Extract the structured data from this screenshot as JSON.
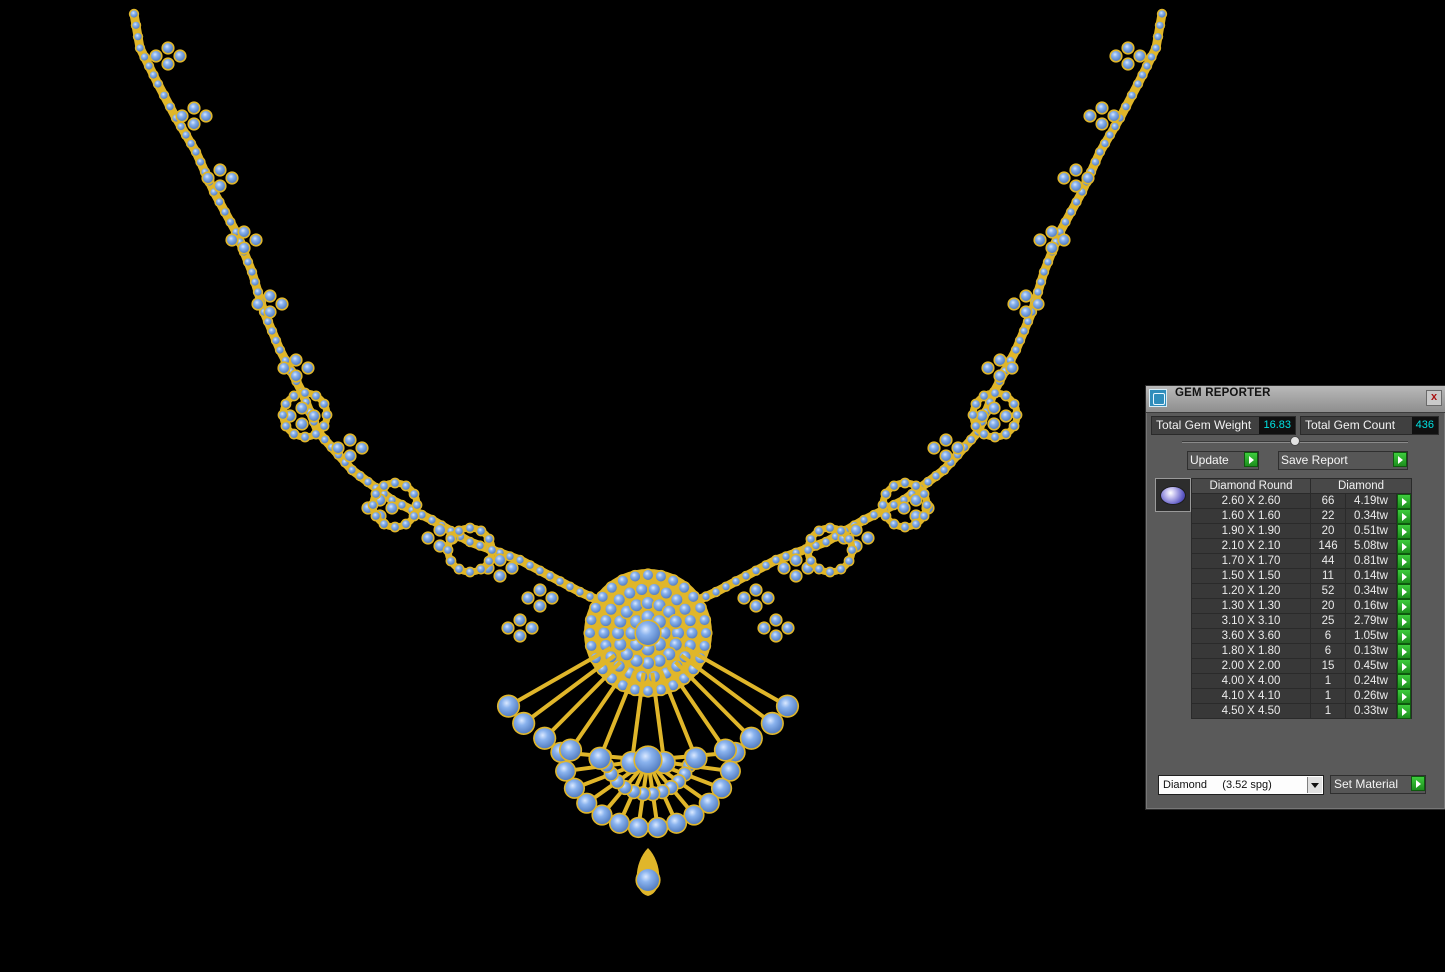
{
  "panel": {
    "title": "GEM REPORTER",
    "close_label": "x",
    "total_weight_label": "Total Gem Weight",
    "total_weight_value": "16.83",
    "total_count_label": "Total Gem Count",
    "total_count_value": "436",
    "update_label": "Update",
    "save_report_label": "Save Report",
    "table": {
      "headers": [
        "Diamond Round",
        "Diamond"
      ],
      "rows": [
        {
          "size": "2.60 X 2.60",
          "count": "66",
          "weight": "4.19tw"
        },
        {
          "size": "1.60 X 1.60",
          "count": "22",
          "weight": "0.34tw"
        },
        {
          "size": "1.90 X 1.90",
          "count": "20",
          "weight": "0.51tw"
        },
        {
          "size": "2.10 X 2.10",
          "count": "146",
          "weight": "5.08tw"
        },
        {
          "size": "1.70 X 1.70",
          "count": "44",
          "weight": "0.81tw"
        },
        {
          "size": "1.50 X 1.50",
          "count": "11",
          "weight": "0.14tw"
        },
        {
          "size": "1.20 X 1.20",
          "count": "52",
          "weight": "0.34tw"
        },
        {
          "size": "1.30 X 1.30",
          "count": "20",
          "weight": "0.16tw"
        },
        {
          "size": "3.10 X 3.10",
          "count": "25",
          "weight": "2.79tw"
        },
        {
          "size": "3.60 X 3.60",
          "count": "6",
          "weight": "1.05tw"
        },
        {
          "size": "1.80 X 1.80",
          "count": "6",
          "weight": "0.13tw"
        },
        {
          "size": "2.00 X 2.00",
          "count": "15",
          "weight": "0.45tw"
        },
        {
          "size": "4.00 X 4.00",
          "count": "1",
          "weight": "0.24tw"
        },
        {
          "size": "4.10 X 4.10",
          "count": "1",
          "weight": "0.26tw"
        },
        {
          "size": "4.50 X 4.50",
          "count": "1",
          "weight": "0.33tw"
        }
      ]
    },
    "material_select": "Diamond     (3.52 spg)",
    "set_material_label": "Set Material"
  },
  "colors": {
    "background": "#000000",
    "gold": "#e0b62a",
    "gem": "#7aa8e8",
    "value_text": "#00e2e2",
    "go_button": "#2fb12f"
  },
  "icons": [
    "gem-reporter-app-icon",
    "close-icon",
    "play-arrow-icon",
    "round-gem-thumbnail",
    "dropdown-arrow-icon"
  ]
}
